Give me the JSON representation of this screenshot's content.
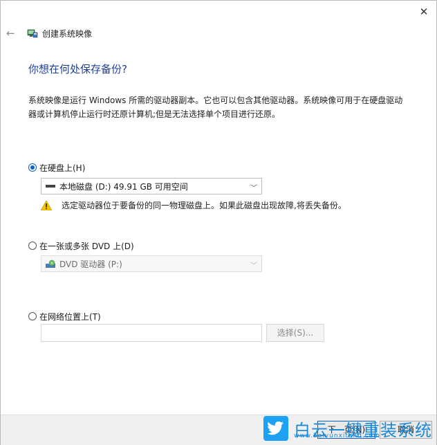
{
  "window": {
    "title": "创建系统映像",
    "close_glyph": "✕",
    "back_glyph": "←"
  },
  "heading": "你想在何处保存备份?",
  "description": "系统映像是运行 Windows 所需的驱动器副本。它也可以包含其他驱动器。系统映像可用于在硬盘驱动器或计算机停止运行时还原计算机;但是无法选择单个项目进行还原。",
  "options": {
    "hard_disk": {
      "label": "在硬盘上(H)",
      "checked": true
    },
    "dvd": {
      "label": "在一张或多张 DVD 上(D)",
      "checked": false
    },
    "network": {
      "label": "在网络位置上(T)",
      "checked": false
    }
  },
  "hard_disk_select": {
    "value": "本地磁盘 (D:)  49.91 GB 可用空间"
  },
  "warning": "选定驱动器位于要备份的同一物理磁盘上。如果此磁盘出现故障,将丢失备份。",
  "dvd_select": {
    "value": "DVD 驱动器 (P:)"
  },
  "network": {
    "input_value": "",
    "browse_label": "选择(S)..."
  },
  "buttons": {
    "next": "下一页(N)",
    "cancel": "取消"
  },
  "watermark": {
    "text": "白云一键重装系统",
    "url": "www.baiyunxitong.com"
  },
  "colors": {
    "accent": "#0a5fc8",
    "heading": "#1f3f93",
    "warning": "#f5c400"
  },
  "icons": {
    "back": "back-arrow-icon",
    "app": "system-image-icon",
    "drive": "hard-drive-icon",
    "dvd": "dvd-drive-icon",
    "warning": "warning-icon",
    "close": "close-icon"
  }
}
